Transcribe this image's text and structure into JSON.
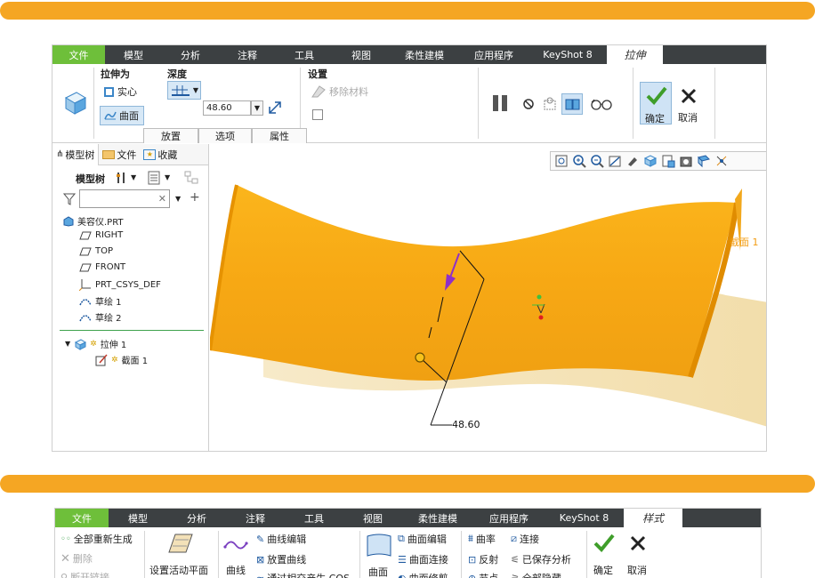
{
  "ribbon1": {
    "menu": [
      {
        "label": "文件",
        "w": 59
      },
      {
        "label": "模型",
        "w": 64
      },
      {
        "label": "分析",
        "w": 64
      },
      {
        "label": "注释",
        "w": 64
      },
      {
        "label": "工具",
        "w": 64
      },
      {
        "label": "视图",
        "w": 64
      },
      {
        "label": "柔性建模",
        "w": 78
      },
      {
        "label": "应用程序",
        "w": 78
      },
      {
        "label": "KeyShot 8",
        "w": 88
      },
      {
        "label": "拉伸",
        "w": 63
      }
    ],
    "extrude_as": "拉伸为",
    "solid": "实心",
    "surface": "曲面",
    "depth": "深度",
    "depth_value": "48.60",
    "settings": "设置",
    "remove_material": "移除材料",
    "tabs": [
      "放置",
      "选项",
      "属性"
    ],
    "ok": "确定",
    "cancel": "取消"
  },
  "panel": {
    "tabs": [
      "模型树",
      "文件",
      "收藏"
    ],
    "tree_label": "模型树",
    "tree": [
      {
        "label": "美容仪.PRT"
      },
      {
        "label": "RIGHT"
      },
      {
        "label": "TOP"
      },
      {
        "label": "FRONT"
      },
      {
        "label": "PRT_CSYS_DEF"
      },
      {
        "label": "草绘 1"
      },
      {
        "label": "草绘 2"
      },
      {
        "label": "拉伸 1"
      },
      {
        "label": "截面 1"
      }
    ]
  },
  "gfx": {
    "section_label": "截面 1",
    "dim_value": "48.60",
    "surface_color": "#f7a814",
    "shadow_color": "#f6e2b0"
  },
  "ribbon2": {
    "menu": [
      {
        "label": "文件",
        "w": 60
      },
      {
        "label": "模型",
        "w": 66
      },
      {
        "label": "分析",
        "w": 66
      },
      {
        "label": "注释",
        "w": 66
      },
      {
        "label": "工具",
        "w": 66
      },
      {
        "label": "视图",
        "w": 66
      },
      {
        "label": "柔性建模",
        "w": 80
      },
      {
        "label": "应用程序",
        "w": 80
      },
      {
        "label": "KeyShot 8",
        "w": 89
      },
      {
        "label": "样式",
        "w": 66
      }
    ],
    "regen_all": "全部重新生成",
    "delete": "删除",
    "break_link": "断开链接",
    "set_active_plane": "设置活动平面",
    "curve": "曲线",
    "curve_edit": "曲线编辑",
    "place_curve": "放置曲线",
    "through_intersection": "通过相交产生 COS",
    "surface": "曲面",
    "surface_edit": "曲面编辑",
    "surface_connect": "曲面连接",
    "surface_trim": "曲面修剪",
    "curvature": "曲率",
    "connect": "连接",
    "reflect": "反射",
    "saved_analysis": "已保存分析",
    "node": "节点",
    "hide_all": "全部隐藏",
    "ok": "确定",
    "cancel": "取消"
  }
}
